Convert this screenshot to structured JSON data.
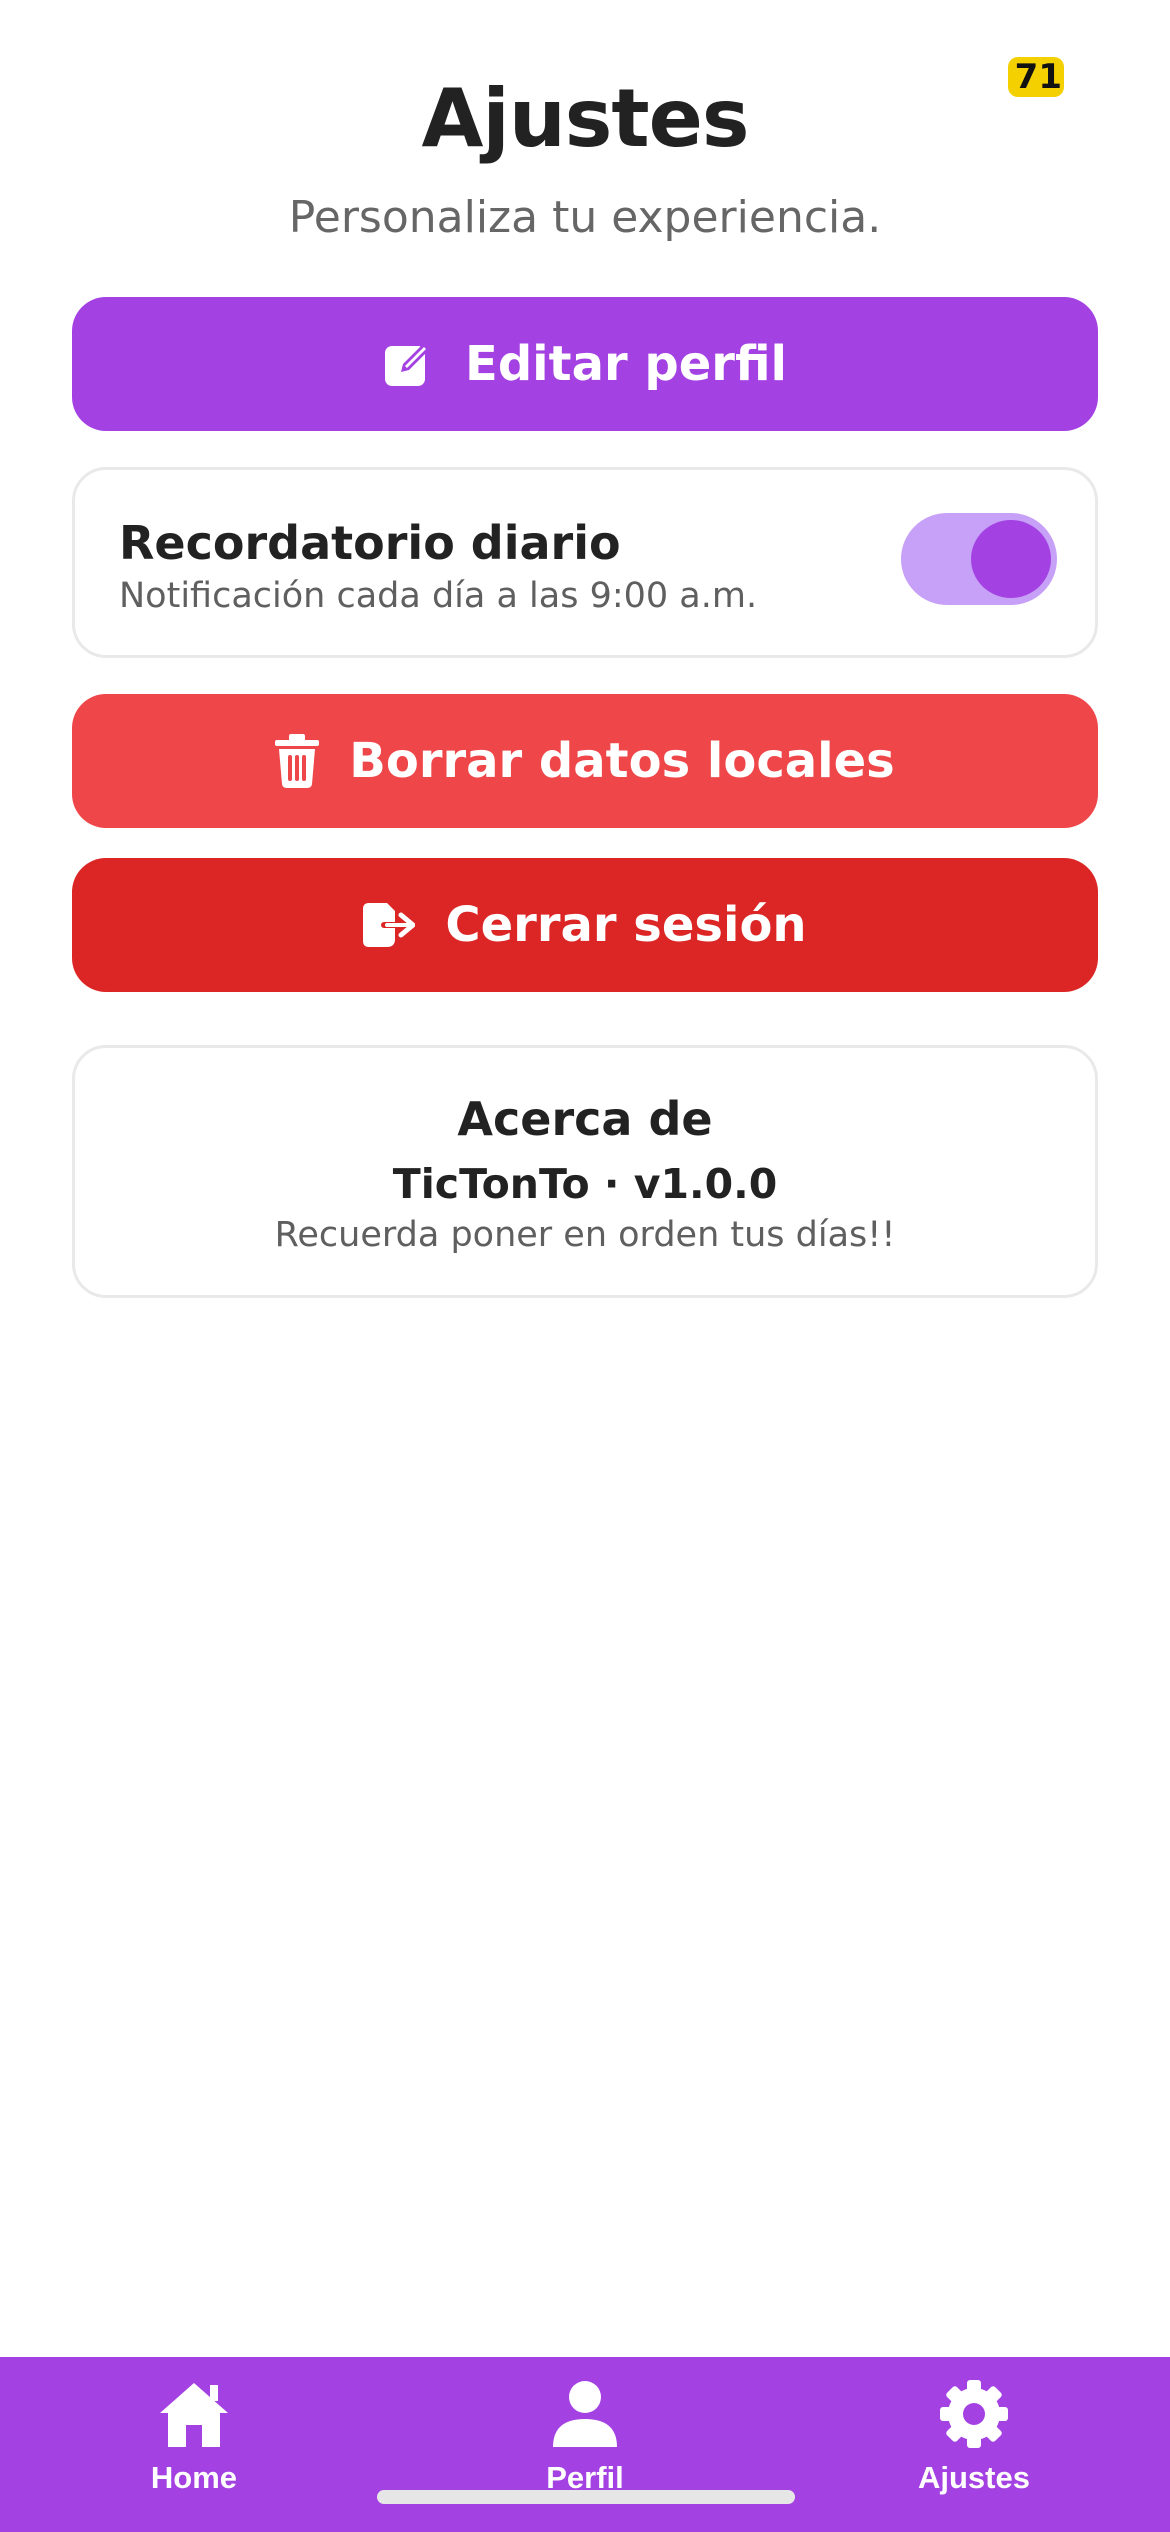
{
  "status": {
    "badge": "71"
  },
  "header": {
    "title": "Ajustes",
    "subtitle": "Personaliza tu experiencia."
  },
  "actions": {
    "edit_profile": "Editar perfil",
    "delete_local_data": "Borrar datos locales",
    "logout": "Cerrar sesión"
  },
  "reminder": {
    "title": "Recordatorio diario",
    "subtitle": "Notificación cada día a las 9:00 a.m.",
    "enabled": true
  },
  "about": {
    "title": "Acerca de",
    "app": "TicTonTo · v1.0.0",
    "tagline": "Recuerda poner en orden tus días!!"
  },
  "tabbar": {
    "items": [
      {
        "label": "Home",
        "icon": "home-icon"
      },
      {
        "label": "Perfil",
        "icon": "person-icon"
      },
      {
        "label": "Ajustes",
        "icon": "gear-icon"
      }
    ],
    "active": "Ajustes"
  },
  "colors": {
    "primary": "#a441e3",
    "danger": "#ef4649",
    "danger_dark": "#dc2626",
    "toggle_track": "#c7a1f7",
    "badge": "#f5d000"
  }
}
